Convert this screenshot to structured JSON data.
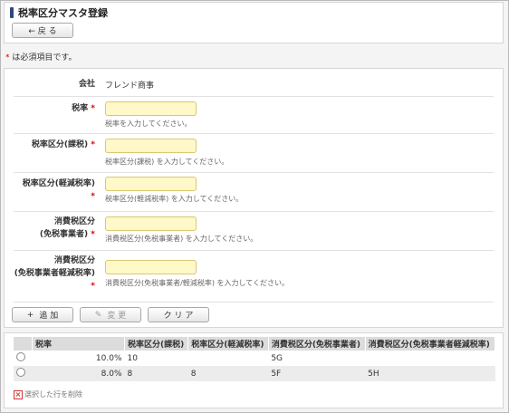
{
  "title": "税率区分マスタ登録",
  "back_button": "← 戻 る",
  "required_note": {
    "star": "*",
    "text": " は必須項目です。"
  },
  "form": {
    "company": {
      "label": "会社",
      "value": "フレンド商事"
    },
    "tax_rate": {
      "label": "税率",
      "hint": "税率を入力してください。"
    },
    "tax_class_taxable": {
      "label": "税率区分(課税)",
      "hint": "税率区分(課税) を入力してください。"
    },
    "tax_class_reduced": {
      "label": "税率区分(軽減税率)",
      "hint": "税率区分(軽減税率) を入力してください。"
    },
    "consumption_exempt": {
      "label_line1": "消費税区分",
      "label_line2": "(免税事業者)",
      "hint": "消費税区分(免税事業者) を入力してください。"
    },
    "consumption_exempt_reduced": {
      "label_line1": "消費税区分",
      "label_line2": "(免税事業者軽減税率)",
      "hint": "消費税区分(免税事業者/軽減税率) を入力してください。"
    },
    "required_star": "*"
  },
  "actions": {
    "add": "追 加",
    "change": "変 更",
    "clear": "ク リ ア"
  },
  "table": {
    "headers": [
      "",
      "税率",
      "税率区分(課税)",
      "税率区分(軽減税率)",
      "消費税区分(免税事業者)",
      "消費税区分(免税事業者軽減税率)"
    ],
    "rows": [
      {
        "rate": "10.0%",
        "taxable": "10",
        "reduced": "",
        "exempt": "5G",
        "exempt_reduced": ""
      },
      {
        "rate": "8.0%",
        "taxable": "8",
        "reduced": "8",
        "exempt": "5F",
        "exempt_reduced": "5H"
      }
    ]
  },
  "delete_selected": "選択した行を削除"
}
